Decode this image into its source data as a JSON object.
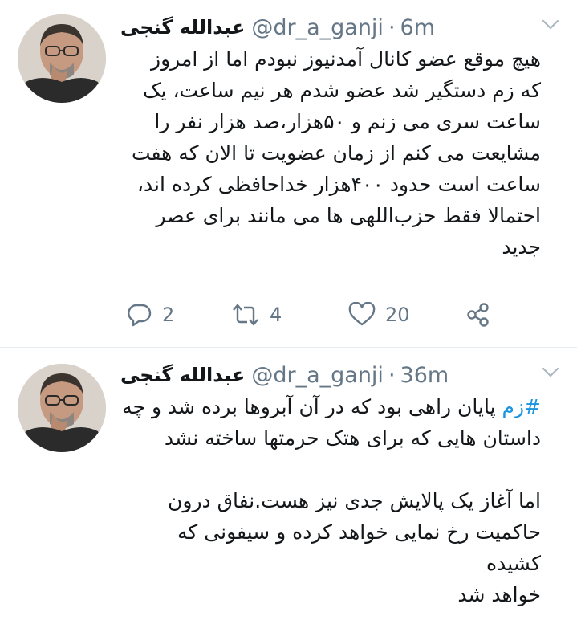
{
  "tweets": [
    {
      "author": {
        "name": "عبدالله گنجی",
        "handle": "@dr_a_ganji"
      },
      "separator": "·",
      "time": "6m",
      "body_lines": [
        "هیچ موقع عضو کانال آمدنیوز نبودم اما از امروز",
        "که زم دستگیر شد عضو شدم هر نیم ساعت، یک",
        "ساعت سری می زنم و ۵۰هزار،صد هزار نفر را",
        "مشایعت می کنم از زمان عضویت تا الان که هفت",
        "ساعت است حدود ۴۰۰هزار خداحافظی کرده اند،",
        "احتمالا فقط حزب‌اللهی ها می مانند برای عصر",
        "جدید"
      ],
      "actions": {
        "reply_count": "2",
        "retweet_count": "4",
        "like_count": "20"
      },
      "icons": [
        "avatar",
        "chevron-down-icon",
        "reply-icon",
        "retweet-icon",
        "like-icon",
        "share-icon"
      ]
    },
    {
      "author": {
        "name": "عبدالله گنجی",
        "handle": "@dr_a_ganji"
      },
      "separator": "·",
      "time": "36m",
      "hashtag": "#زم",
      "line1_rest": " پایان راهی بود که در آن آبروها برده شد و چه",
      "body_lines": [
        "داستان هایی که برای هتک حرمتها ساخته نشد",
        "",
        "اما آغاز یک پالایش جدی نیز هست.نفاق درون",
        "حاکمیت رخ نمایی خواهد کرده و سیفونی که کشیده",
        "خواهد شد"
      ]
    }
  ],
  "colors": {
    "text": "#14171a",
    "muted": "#657786",
    "link": "#1b95e0",
    "divider": "#e6ecf0"
  }
}
